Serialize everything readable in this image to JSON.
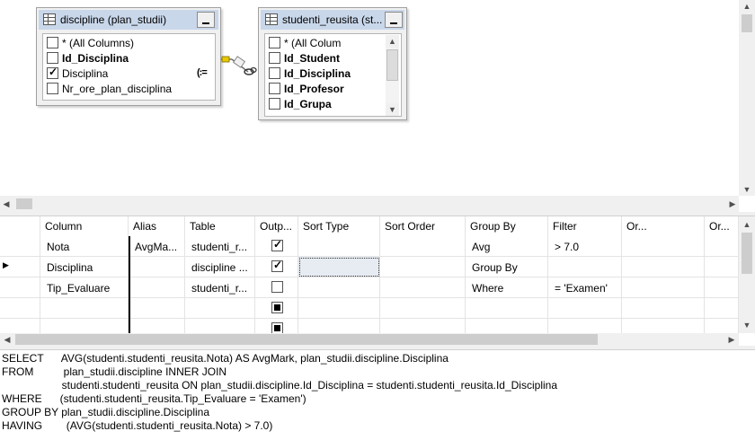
{
  "diagram": {
    "table1": {
      "title": "discipline (plan_studii)",
      "rows": [
        {
          "label": "* (All Columns)",
          "checked": false,
          "bold": false
        },
        {
          "label": "Id_Disciplina",
          "checked": false,
          "bold": true
        },
        {
          "label": "Disciplina",
          "checked": true,
          "bold": false
        },
        {
          "label": "Nr_ore_plan_disciplina",
          "checked": false,
          "bold": false
        }
      ],
      "groupby_marker": "(:="
    },
    "table2": {
      "title": "studenti_reusita (st...",
      "rows": [
        {
          "label": "* (All Colum",
          "checked": false,
          "bold": false
        },
        {
          "label": "Id_Student",
          "checked": false,
          "bold": true
        },
        {
          "label": "Id_Disciplina",
          "checked": false,
          "bold": true
        },
        {
          "label": "Id_Profesor",
          "checked": false,
          "bold": true
        },
        {
          "label": "Id_Grupa",
          "checked": false,
          "bold": true
        }
      ]
    }
  },
  "grid": {
    "headers": [
      "Column",
      "Alias",
      "Table",
      "Outp...",
      "Sort Type",
      "Sort Order",
      "Group By",
      "Filter",
      "Or...",
      "Or..."
    ],
    "rows": [
      {
        "column": "Nota",
        "alias": "AvgMa...",
        "table": "studenti_r...",
        "output": "checked",
        "sort_type": "",
        "sort_order": "",
        "group_by": "Avg",
        "filter": "> 7.0",
        "current": false
      },
      {
        "column": "Disciplina",
        "alias": "",
        "table": "discipline ...",
        "output": "checked",
        "sort_type": "",
        "sort_order": "",
        "group_by": "Group By",
        "filter": "",
        "current": true
      },
      {
        "column": "Tip_Evaluare",
        "alias": "",
        "table": "studenti_r...",
        "output": "unchecked",
        "sort_type": "",
        "sort_order": "",
        "group_by": "Where",
        "filter": "= 'Examen'",
        "current": false
      },
      {
        "column": "",
        "alias": "",
        "table": "",
        "output": "indeterminate",
        "sort_type": "",
        "sort_order": "",
        "group_by": "",
        "filter": "",
        "current": false
      },
      {
        "column": "",
        "alias": "",
        "table": "",
        "output": "indeterminate",
        "sort_type": "",
        "sort_order": "",
        "group_by": "",
        "filter": "",
        "current": false
      }
    ]
  },
  "sql": {
    "lines": [
      "SELECT      AVG(studenti.studenti_reusita.Nota) AS AvgMark, plan_studii.discipline.Disciplina",
      "FROM          plan_studii.discipline INNER JOIN",
      "                    studenti.studenti_reusita ON plan_studii.discipline.Id_Disciplina = studenti.studenti_reusita.Id_Disciplina",
      "WHERE      (studenti.studenti_reusita.Tip_Evaluare = 'Examen')",
      "GROUP BY plan_studii.discipline.Disciplina",
      "HAVING        (AVG(studenti.studenti_reusita.Nota) > 7.0)"
    ]
  },
  "icons": {
    "table": "table-icon",
    "minimize": "minimize-icon",
    "join": "join-key-icon",
    "scroll_up": "▲",
    "scroll_down": "▼",
    "scroll_left": "◀",
    "scroll_right": "▶",
    "current_row": "▶"
  }
}
